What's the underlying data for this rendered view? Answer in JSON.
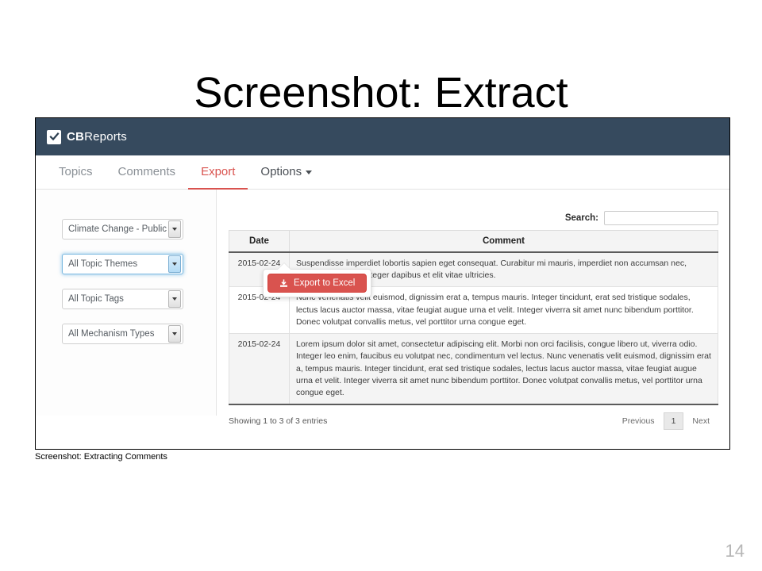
{
  "slide": {
    "title": "Screenshot: Extract",
    "caption": "Screenshot: Extracting Comments",
    "page_number": "14"
  },
  "colors": {
    "navbar": "#364a5e",
    "accent_red": "#d9534f",
    "active_tab": "#d9534f",
    "table_header_bg": "#f4f4f4",
    "row_stripe": "#f4f4f4",
    "focus_blue": "#7cb9e0"
  },
  "app": {
    "brand": {
      "icon": "checkbox-checked-icon",
      "text_bold": "CB",
      "text_regular": "Reports"
    },
    "tabs": [
      {
        "label": "Topics",
        "active": false,
        "caret": false
      },
      {
        "label": "Comments",
        "active": false,
        "caret": false
      },
      {
        "label": "Export",
        "active": true,
        "caret": false
      },
      {
        "label": "Options",
        "active": false,
        "caret": true
      }
    ],
    "popover": {
      "button_label": "Export to Excel",
      "button_icon": "download-icon"
    },
    "filters": [
      {
        "value": "Climate Change - Public Co",
        "focused": false
      },
      {
        "value": "All Topic Themes",
        "focused": true
      },
      {
        "value": "All Topic Tags",
        "focused": false
      },
      {
        "value": "All Mechanism Types",
        "focused": false
      }
    ],
    "search": {
      "label": "Search:",
      "value": "",
      "placeholder": ""
    },
    "table": {
      "columns": [
        "Date",
        "Comment"
      ],
      "rows": [
        {
          "date": "2015-02-24",
          "comment": "Suspendisse imperdiet lobortis sapien eget consequat. Curabitur mi mauris, imperdiet non accumsan nec, interdum id tortor. Integer dapibus et elit vitae ultricies."
        },
        {
          "date": "2015-02-24",
          "comment": "Nunc venenatis velit euismod, dignissim erat a, tempus mauris. Integer tincidunt, erat sed tristique sodales, lectus lacus auctor massa, vitae feugiat augue urna et velit. Integer viverra sit amet nunc bibendum porttitor. Donec volutpat convallis metus, vel porttitor urna congue eget."
        },
        {
          "date": "2015-02-24",
          "comment": "Lorem ipsum dolor sit amet, consectetur adipiscing elit. Morbi non orci facilisis, congue libero ut, viverra odio. Integer leo enim, faucibus eu volutpat nec, condimentum vel lectus. Nunc venenatis velit euismod, dignissim erat a, tempus mauris. Integer tincidunt, erat sed tristique sodales, lectus lacus auctor massa, vitae feugiat augue urna et velit. Integer viverra sit amet nunc bibendum porttitor. Donec volutpat convallis metus, vel porttitor urna congue eget."
        }
      ]
    },
    "footer": {
      "info": "Showing 1 to 3 of 3 entries",
      "previous": "Previous",
      "current_page": "1",
      "next": "Next"
    }
  }
}
